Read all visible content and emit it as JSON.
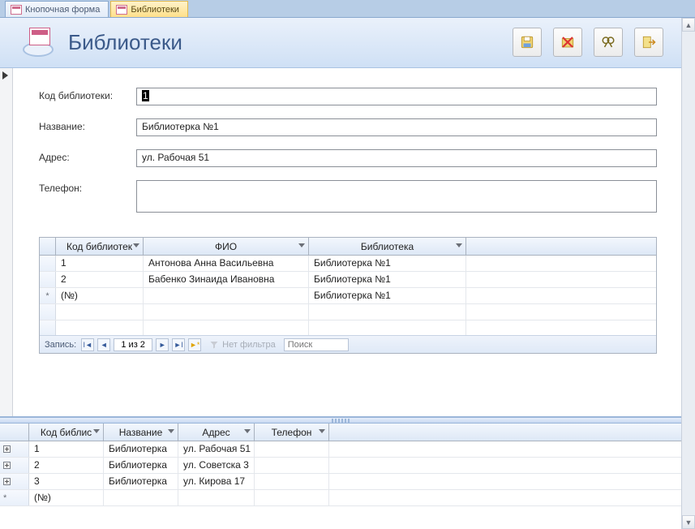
{
  "tabs": [
    {
      "label": "Кнопочная форма",
      "active": false
    },
    {
      "label": "Библиотеки",
      "active": true
    }
  ],
  "header": {
    "title": "Библиотеки"
  },
  "toolbar_icons": [
    "save-icon",
    "delete-icon",
    "find-icon",
    "exit-icon"
  ],
  "form": {
    "fields": [
      {
        "label": "Код библиотеки:",
        "value": "1"
      },
      {
        "label": "Название:",
        "value": "Библиотерка №1"
      },
      {
        "label": "Адрес:",
        "value": "ул. Рабочая 51"
      },
      {
        "label": "Телефон:",
        "value": ""
      }
    ]
  },
  "subform": {
    "columns": [
      "Код библиотек",
      "ФИО",
      "Библиотека"
    ],
    "rows": [
      {
        "sel": "",
        "cells": [
          "1",
          "Антонова Анна Васильевна",
          "Библиотерка №1"
        ]
      },
      {
        "sel": "",
        "cells": [
          "2",
          "Бабенко Зинаида Ивановна",
          "Библиотерка №1"
        ]
      },
      {
        "sel": "*",
        "cells": [
          "(№)",
          "",
          "Библиотерка №1"
        ]
      }
    ],
    "nav": {
      "label": "Запись:",
      "position": "1 из 2",
      "filter_label": "Нет фильтра",
      "search_label": "Поиск"
    }
  },
  "bottom": {
    "columns": [
      "Код библис",
      "Название",
      "Адрес",
      "Телефон"
    ],
    "rows": [
      {
        "sel": "",
        "exp": true,
        "cells": [
          "1",
          "Библиотерка",
          "ул. Рабочая 51",
          ""
        ]
      },
      {
        "sel": "",
        "exp": true,
        "cells": [
          "2",
          "Библиотерка",
          "ул. Советска 3",
          ""
        ]
      },
      {
        "sel": "",
        "exp": true,
        "cells": [
          "3",
          "Библиотерка",
          "ул. Кирова 17",
          ""
        ]
      },
      {
        "sel": "*",
        "exp": false,
        "cells": [
          "(№)",
          "",
          "",
          ""
        ]
      }
    ]
  }
}
